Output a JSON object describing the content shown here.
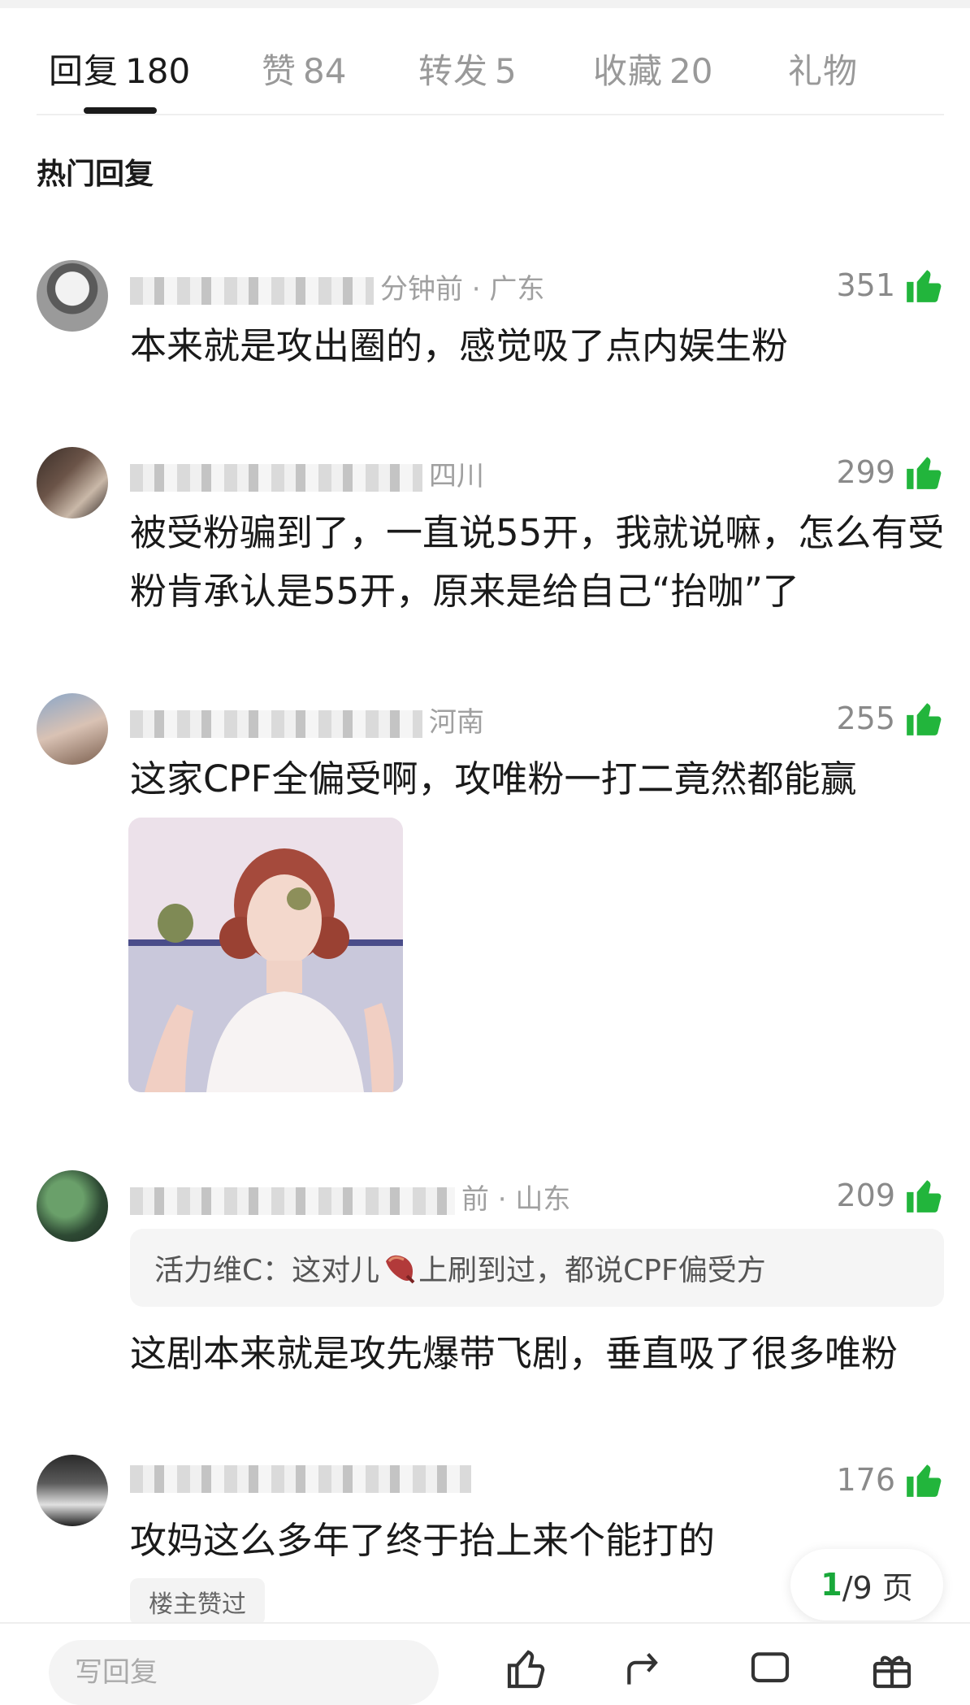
{
  "tabs": [
    {
      "label": "回复",
      "count": "180",
      "active": true
    },
    {
      "label": "赞",
      "count": "84"
    },
    {
      "label": "转发",
      "count": "5"
    },
    {
      "label": "收藏",
      "count": "20"
    },
    {
      "label": "礼物",
      "count": ""
    }
  ],
  "section_title": "热门回复",
  "comments": [
    {
      "meta": "分钟前 · 广东",
      "likes": "351",
      "text": "本来就是攻出圈的，感觉吸了点内娱生粉"
    },
    {
      "meta": "四川",
      "likes": "299",
      "text": "被受粉骗到了，一直说55开，我就说嘛，怎么有受粉肯承认是55开，原来是给自己“抬咖”了"
    },
    {
      "meta": "河南",
      "likes": "255",
      "text": "这家CPF全偏受啊，攻唯粉一打二竟然都能赢"
    },
    {
      "meta": "前 · 山东",
      "likes": "209",
      "quote_user": "活力维C：",
      "quote_text_a": "这对儿",
      "quote_text_b": "上刷到过，都说CPF偏受方",
      "text": "这剧本来就是攻先爆带飞剧，垂直吸了很多唯粉"
    },
    {
      "meta": "",
      "likes": "176",
      "text": "攻妈这么多年了终于抬上来个能打的",
      "badge": "楼主赞过"
    }
  ],
  "pagination": {
    "current": "1",
    "total_text": "/9 页"
  },
  "bottom_bar": {
    "reply_placeholder": "写回复"
  },
  "colors": {
    "accent_green": "#19a83a",
    "thumb_green": "#22b53c"
  }
}
